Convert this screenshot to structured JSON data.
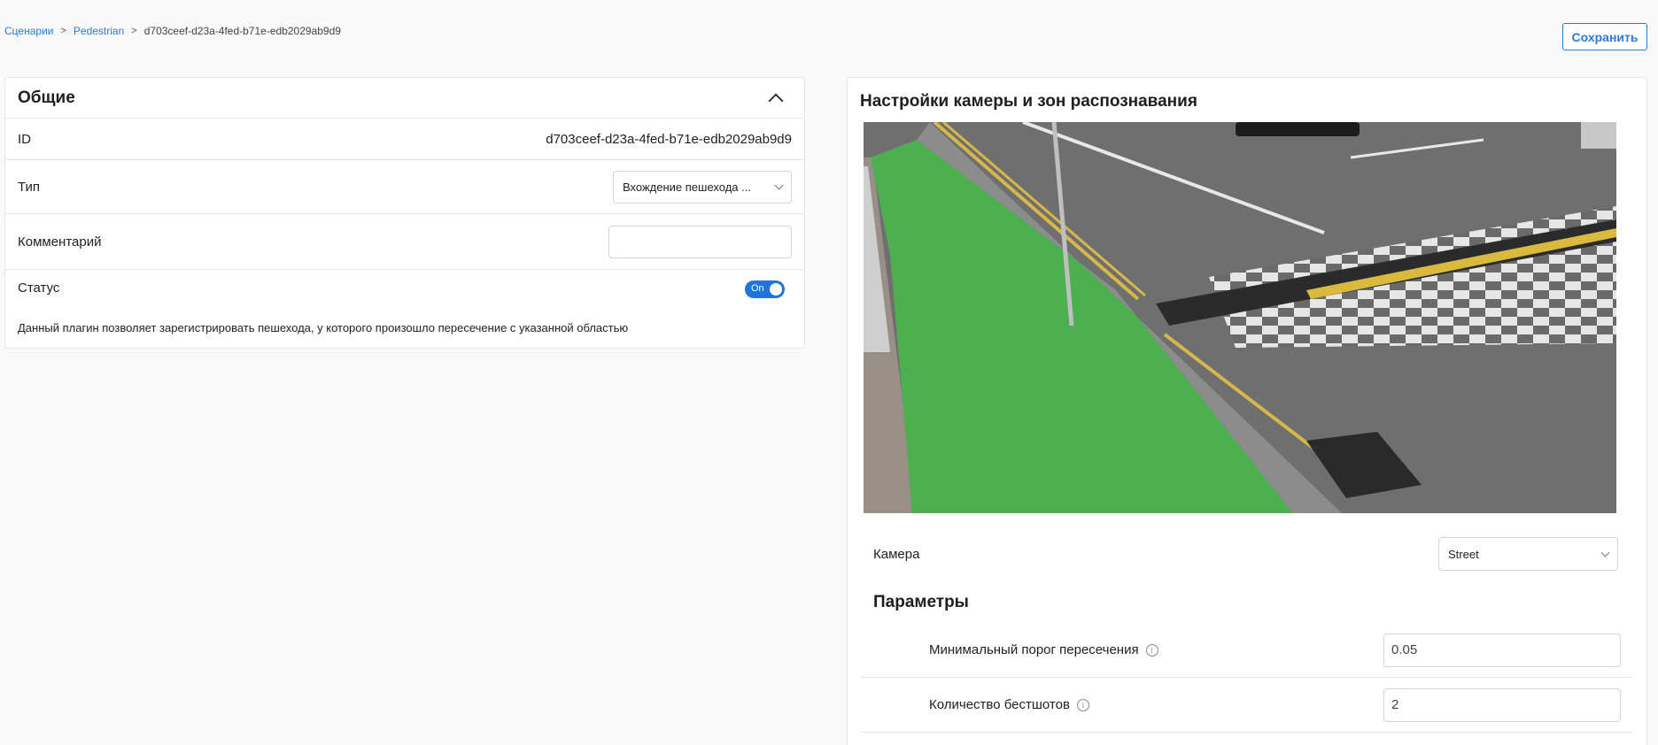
{
  "breadcrumb": {
    "items": [
      "Сценарии",
      "Pedestrian"
    ],
    "separator": ">",
    "current": "d703ceef-d23a-4fed-b71e-edb2029ab9d9"
  },
  "header": {
    "save_label": "Сохранить"
  },
  "general": {
    "title": "Общие",
    "id_label": "ID",
    "id_value": "d703ceef-d23a-4fed-b71e-edb2029ab9d9",
    "type_label": "Тип",
    "type_value": "Вхождение пешехода ...",
    "comment_label": "Комментарий",
    "comment_value": "",
    "status_label": "Статус",
    "status_toggle": "On",
    "description": "Данный плагин позволяет зарегистрировать пешехода, у которого произошло пересечение с указанной областью"
  },
  "camera_settings": {
    "title": "Настройки камеры и зон распознавания",
    "camera_label": "Камера",
    "camera_value": "Street",
    "params_title": "Параметры",
    "params": [
      {
        "label": "Минимальный порог пересечения",
        "value": "0.05"
      },
      {
        "label": "Количество бестшотов",
        "value": "2"
      }
    ]
  },
  "colors": {
    "accent": "#1f73d9",
    "zone_green": "#4caf50"
  }
}
